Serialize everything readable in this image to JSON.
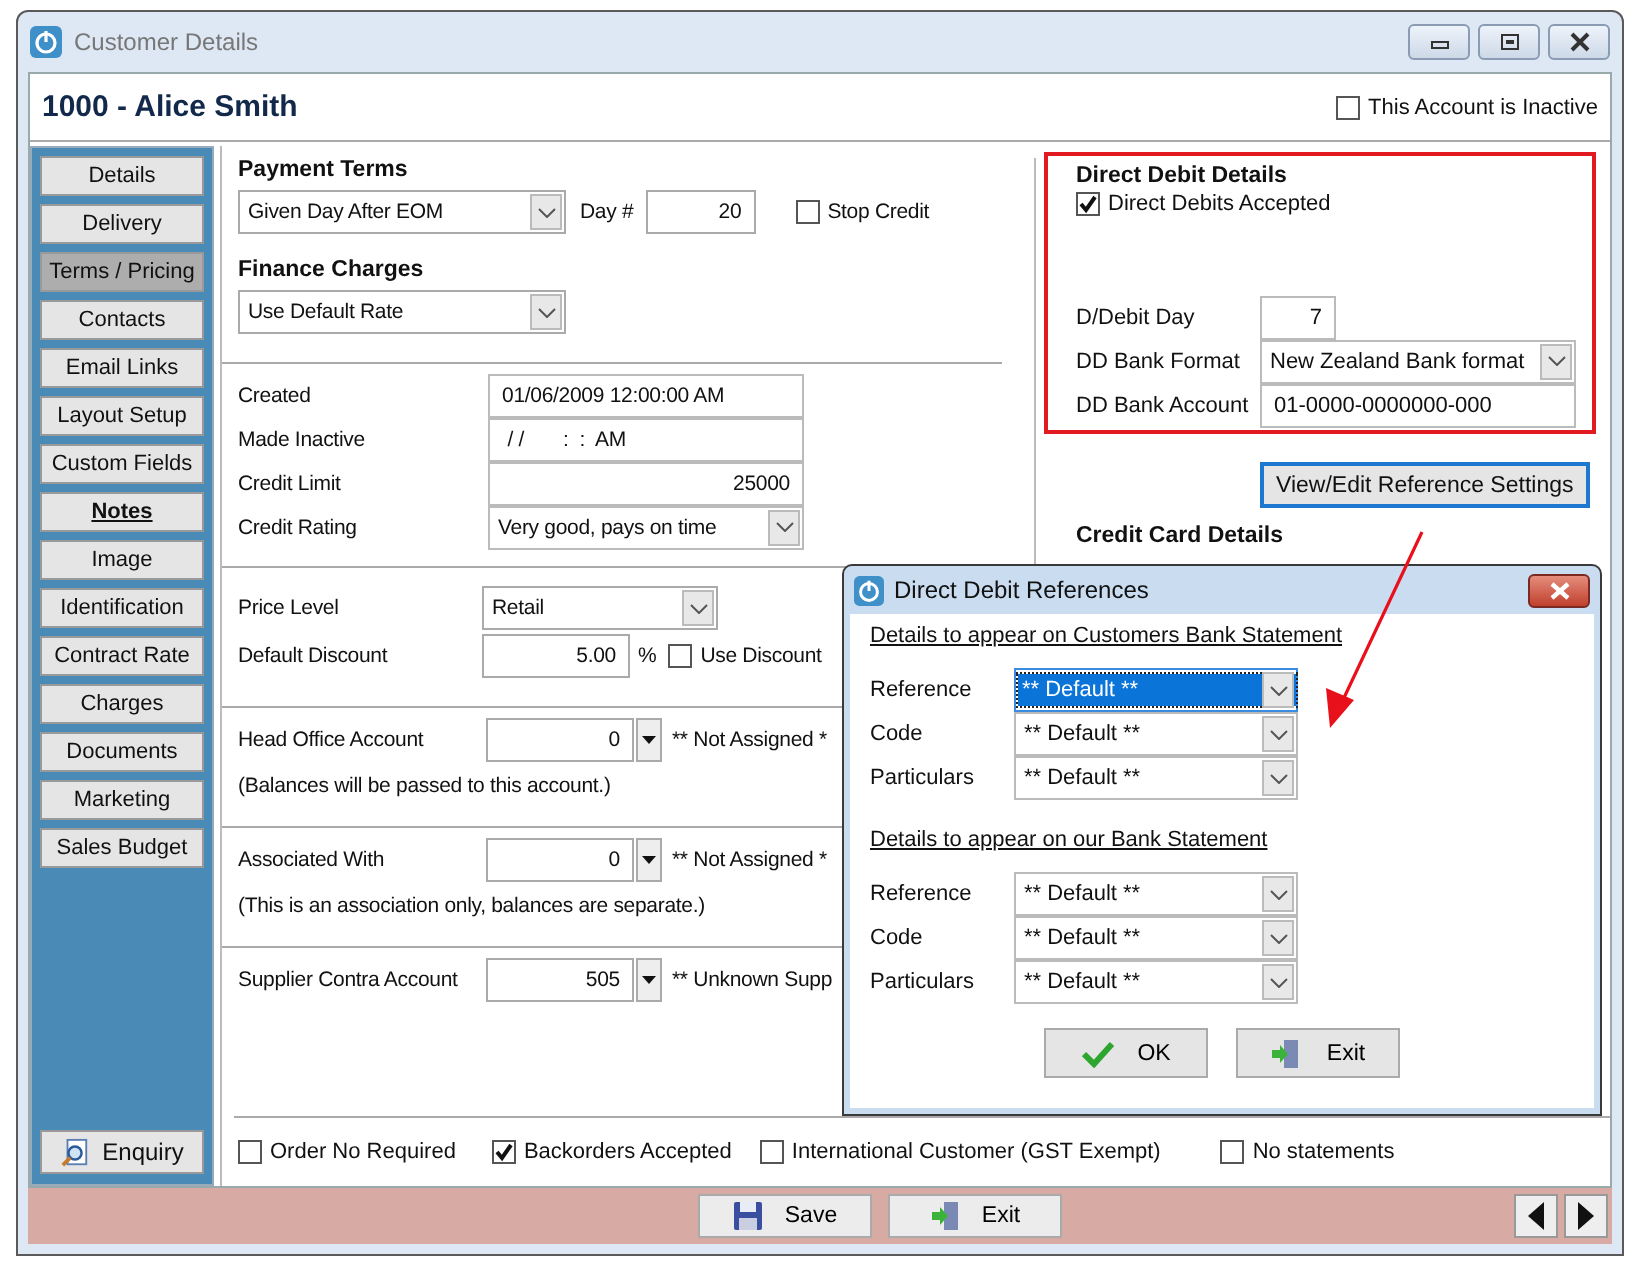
{
  "window": {
    "title": "Customer Details"
  },
  "header": {
    "customer": "1000 - Alice Smith",
    "inactive": {
      "label": "This Account is Inactive",
      "checked": false
    }
  },
  "sidebar": {
    "items": [
      {
        "label": "Details",
        "selected": false,
        "bold": false
      },
      {
        "label": "Delivery",
        "selected": false,
        "bold": false
      },
      {
        "label": "Terms / Pricing",
        "selected": true,
        "bold": false
      },
      {
        "label": "Contacts",
        "selected": false,
        "bold": false
      },
      {
        "label": "Email Links",
        "selected": false,
        "bold": false
      },
      {
        "label": "Layout Setup",
        "selected": false,
        "bold": false
      },
      {
        "label": "Custom Fields",
        "selected": false,
        "bold": false
      },
      {
        "label": "Notes",
        "selected": false,
        "bold": true
      },
      {
        "label": "Image",
        "selected": false,
        "bold": false
      },
      {
        "label": "Identification",
        "selected": false,
        "bold": false
      },
      {
        "label": "Contract Rate",
        "selected": false,
        "bold": false
      },
      {
        "label": "Charges",
        "selected": false,
        "bold": false
      },
      {
        "label": "Documents",
        "selected": false,
        "bold": false
      },
      {
        "label": "Marketing",
        "selected": false,
        "bold": false
      },
      {
        "label": "Sales Budget",
        "selected": false,
        "bold": false
      }
    ],
    "enquiry": "Enquiry"
  },
  "payment_terms": {
    "heading": "Payment Terms",
    "value": "Given Day After EOM",
    "day_label": "Day #",
    "day_value": "20",
    "stop_credit": {
      "label": "Stop Credit",
      "checked": false
    }
  },
  "finance_charges": {
    "heading": "Finance Charges",
    "value": "Use Default Rate"
  },
  "account_fields": [
    {
      "label": "Created",
      "value": "01/06/2009 12:00:00 AM",
      "kind": "text"
    },
    {
      "label": "Made Inactive",
      "value": " / /       :  :  AM",
      "kind": "text"
    },
    {
      "label": "Credit Limit",
      "value": "25000",
      "kind": "number"
    },
    {
      "label": "Credit Rating",
      "value": "Very good, pays on time",
      "kind": "dropdown"
    }
  ],
  "pricing": {
    "price_level": {
      "label": "Price Level",
      "value": "Retail"
    },
    "discount": {
      "label": "Default Discount",
      "value": "5.00",
      "unit": "%"
    },
    "use_discount": {
      "label": "Use Discount",
      "checked": false
    }
  },
  "linked_accounts": [
    {
      "label": "Head Office Account",
      "value": "0",
      "status": "** Not Assigned *",
      "note": "(Balances will be passed to this account.)"
    },
    {
      "label": "Associated With",
      "value": "0",
      "status": "** Not Assigned *",
      "note": "(This is an association only, balances are separate.)"
    },
    {
      "label": "Supplier Contra Account",
      "value": "505",
      "status": "** Unknown Supp"
    }
  ],
  "options": [
    {
      "label": "Order No Required",
      "checked": false
    },
    {
      "label": "Backorders Accepted",
      "checked": true
    },
    {
      "label": "International Customer (GST Exempt)",
      "checked": false
    },
    {
      "label": "No statements",
      "checked": false
    }
  ],
  "direct_debit": {
    "heading": "Direct Debit Details",
    "accepted": {
      "label": "Direct Debits Accepted",
      "checked": true
    },
    "fields": [
      {
        "label": "D/Debit Day",
        "value": "7",
        "kind": "short"
      },
      {
        "label": "DD Bank Format",
        "value": "New Zealand Bank format",
        "kind": "dropdown"
      },
      {
        "label": "DD Bank Account",
        "value": "01-0000-0000000-000",
        "kind": "text"
      }
    ],
    "button": "View/Edit Reference Settings"
  },
  "credit_card": {
    "heading": "Credit Card Details"
  },
  "footer": {
    "buttons": [
      {
        "label": "Save",
        "kind": "save"
      },
      {
        "label": "Exit",
        "kind": "exit"
      }
    ]
  },
  "dialog": {
    "title": "Direct Debit References",
    "sections": [
      {
        "heading": "Details to appear on Customers Bank Statement",
        "rows": [
          {
            "label": "Reference",
            "value": "** Default **",
            "selected": true
          },
          {
            "label": "Code",
            "value": "** Default **",
            "selected": false
          },
          {
            "label": "Particulars",
            "value": "** Default **",
            "selected": false
          }
        ]
      },
      {
        "heading": "Details to appear on our Bank Statement",
        "rows": [
          {
            "label": "Reference",
            "value": "** Default **",
            "selected": false
          },
          {
            "label": "Code",
            "value": "** Default **",
            "selected": false
          },
          {
            "label": "Particulars",
            "value": "** Default **",
            "selected": false
          }
        ]
      }
    ],
    "buttons": [
      {
        "label": "OK",
        "kind": "ok"
      },
      {
        "label": "Exit",
        "kind": "exit"
      }
    ]
  }
}
